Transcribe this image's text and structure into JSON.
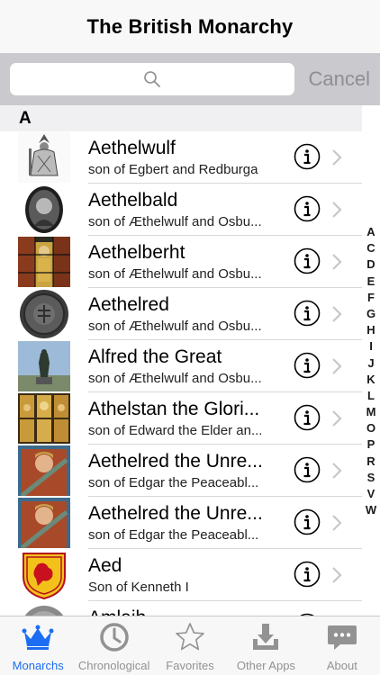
{
  "nav": {
    "title": "The British Monarchy"
  },
  "search": {
    "placeholder": "",
    "cancel_label": "Cancel"
  },
  "section": {
    "letter": "A"
  },
  "rows": [
    {
      "name": "Aethelwulf",
      "sub": "son of Egbert and Redburga"
    },
    {
      "name": "Aethelbald",
      "sub": "son of Æthelwulf and Osbu..."
    },
    {
      "name": "Aethelberht",
      "sub": "son of Æthelwulf and Osbu..."
    },
    {
      "name": "Aethelred",
      "sub": "son of Æthelwulf and Osbu..."
    },
    {
      "name": "Alfred the Great",
      "sub": "son of Æthelwulf and Osbu..."
    },
    {
      "name": "Athelstan the Glori...",
      "sub": "son of Edward the Elder an..."
    },
    {
      "name": "Aethelred the Unre...",
      "sub": "son of Edgar the Peaceabl..."
    },
    {
      "name": "Aethelred the Unre...",
      "sub": "son of Edgar the Peaceabl..."
    },
    {
      "name": "Aed",
      "sub": "Son of Kenneth I"
    },
    {
      "name": "Amlaib",
      "sub": ""
    }
  ],
  "index_letters": [
    "A",
    "C",
    "D",
    "E",
    "F",
    "G",
    "H",
    "I",
    "J",
    "K",
    "L",
    "M",
    "O",
    "P",
    "R",
    "S",
    "V",
    "W"
  ],
  "tabs": [
    {
      "label": "Monarchs",
      "icon": "crown-icon"
    },
    {
      "label": "Chronological",
      "icon": "clock-icon"
    },
    {
      "label": "Favorites",
      "icon": "star-icon"
    },
    {
      "label": "Other Apps",
      "icon": "download-icon"
    },
    {
      "label": "About",
      "icon": "chat-bubble-icon"
    }
  ],
  "colors": {
    "accent": "#1b6ef3",
    "tab_inactive": "#929292",
    "search_bg": "#c9c9ce"
  }
}
